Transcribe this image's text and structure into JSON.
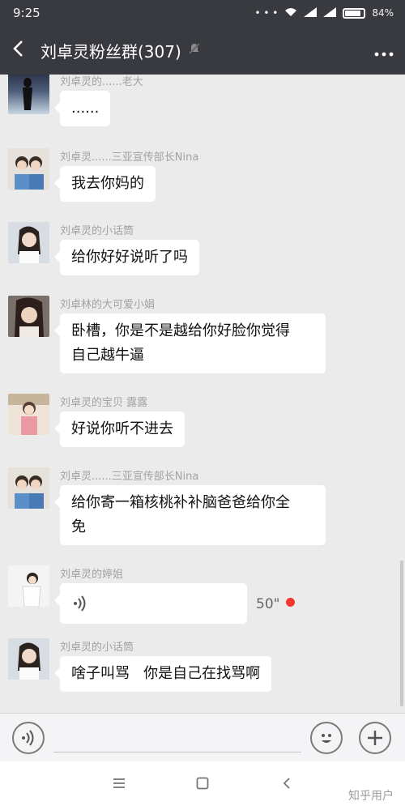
{
  "status": {
    "time": "9:25",
    "battery_text": "84%",
    "battery_level": 0.84
  },
  "header": {
    "back_icon": "back-arrow-icon",
    "title": "刘卓灵粉丝群(307)",
    "mute_icon": "muted-bell-icon",
    "more_icon": "more-dots-icon"
  },
  "messages": [
    {
      "sender": "刘卓灵的......老大",
      "text": "......"
    },
    {
      "sender": "刘卓灵......三亚宣传部长Nina",
      "text": "我去你妈的"
    },
    {
      "sender": "刘卓灵的小话筒",
      "text": "给你好好说听了吗"
    },
    {
      "sender": "刘卓林的大可爱小娟",
      "line1": "卧槽，你是不是越给你好脸你觉得",
      "line2": "自己越牛逼"
    },
    {
      "sender": "刘卓灵的宝贝 露露",
      "text": "好说你听不进去"
    },
    {
      "sender": "刘卓灵......三亚宣传部长Nina",
      "line1": "给你寄一箱核桃补补脑爸爸给你全",
      "line2": "免"
    },
    {
      "sender": "刘卓灵的婷姐",
      "voice_length": "50\"",
      "voice_icon": "voice-wave-icon",
      "unread_color": "#f43530"
    },
    {
      "sender": "刘卓灵的小话筒",
      "text": "啥子叫骂   你是自己在找骂啊"
    }
  ],
  "inputbar": {
    "voice_icon": "voice-input-icon",
    "emoji_icon": "emoji-icon",
    "plus_icon": "plus-icon"
  },
  "navbar": {
    "menu_icon": "menu-icon",
    "home_icon": "home-square-icon",
    "back_icon": "back-icon",
    "watermark": "知乎用户"
  }
}
